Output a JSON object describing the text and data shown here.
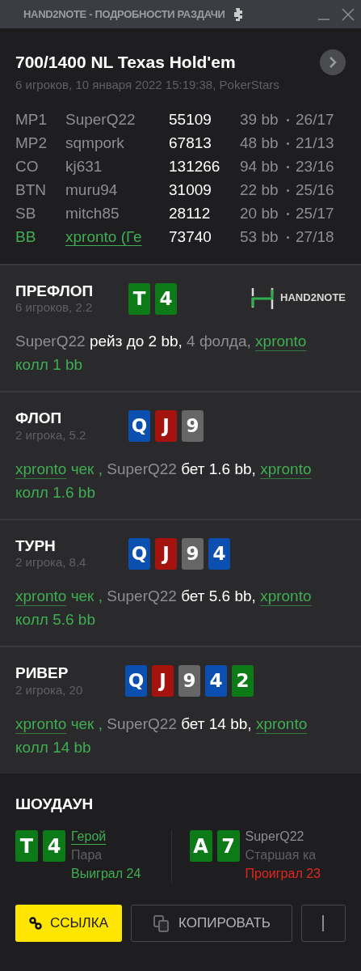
{
  "window": {
    "title": "HAND2NOTE - ПОДРОБНОСТИ РАЗДАЧИ"
  },
  "hand": {
    "title": "700/1400 NL Texas Hold'em",
    "subtitle": "6 игроков, 10 января 2022 15:19:38, PokerStars"
  },
  "players": [
    {
      "position": "MP1",
      "name": "SuperQ22",
      "stack": "55109",
      "bb": "39 bb",
      "stats": "26/17",
      "hero": false
    },
    {
      "position": "MP2",
      "name": "sqmpork",
      "stack": "67813",
      "bb": "48 bb",
      "stats": "21/13",
      "hero": false
    },
    {
      "position": "CO",
      "name": "kj631",
      "stack": "131266",
      "bb": "94 bb",
      "stats": "23/16",
      "hero": false
    },
    {
      "position": "BTN",
      "name": "muru94",
      "stack": "31009",
      "bb": "22 bb",
      "stats": "25/16",
      "hero": false
    },
    {
      "position": "SB",
      "name": "mitch85",
      "stack": "28112",
      "bb": "20 bb",
      "stats": "25/17",
      "hero": false
    },
    {
      "position": "BB",
      "name": "xpronto (Ге",
      "stack": "73740",
      "bb": "53 bb",
      "stats": "27/18",
      "hero": true
    }
  ],
  "streets": [
    {
      "name": "ПРЕФЛОП",
      "info": "6 игроков, 2.2",
      "logo": "HAND2NOTE",
      "cards": [
        {
          "rank": "T",
          "color": "#0b7a17"
        },
        {
          "rank": "4",
          "color": "#0b7a17"
        }
      ],
      "actions": [
        {
          "kind": "player",
          "text": "SuperQ22"
        },
        {
          "kind": "action",
          "text": " рейз до 2 bb,"
        },
        {
          "kind": "player",
          "text": " 4 фолда, "
        },
        {
          "kind": "hero",
          "text": "xpronto"
        },
        {
          "kind": "hero_action",
          "text": " колл 1 bb"
        }
      ]
    },
    {
      "name": "ФЛОП",
      "info": "2 игрока, 5.2",
      "cards": [
        {
          "rank": "Q",
          "color": "#0b50b0"
        },
        {
          "rank": "J",
          "color": "#a5130f"
        },
        {
          "rank": "9",
          "color": "#666666"
        }
      ],
      "actions": [
        {
          "kind": "hero",
          "text": "xpronto"
        },
        {
          "kind": "hero_action",
          "text": " чек ,"
        },
        {
          "kind": "player",
          "text": " SuperQ22"
        },
        {
          "kind": "action",
          "text": " бет 1.6 bb, "
        },
        {
          "kind": "hero",
          "text": "xpronto"
        },
        {
          "kind": "hero_action",
          "text": " колл 1.6 bb"
        }
      ]
    },
    {
      "name": "ТУРН",
      "info": "2 игрока, 8.4",
      "cards": [
        {
          "rank": "Q",
          "color": "#0b50b0"
        },
        {
          "rank": "J",
          "color": "#a5130f"
        },
        {
          "rank": "9",
          "color": "#666666"
        },
        {
          "rank": "4",
          "color": "#0b50b0"
        }
      ],
      "actions": [
        {
          "kind": "hero",
          "text": "xpronto"
        },
        {
          "kind": "hero_action",
          "text": " чек ,"
        },
        {
          "kind": "player",
          "text": " SuperQ22"
        },
        {
          "kind": "action",
          "text": " бет 5.6 bb, "
        },
        {
          "kind": "hero",
          "text": "xpronto"
        },
        {
          "kind": "hero_action",
          "text": " колл 5.6 bb"
        }
      ]
    },
    {
      "name": "РИВЕР",
      "info": "2 игрока, 20",
      "cards": [
        {
          "rank": "Q",
          "color": "#0b50b0"
        },
        {
          "rank": "J",
          "color": "#a5130f"
        },
        {
          "rank": "9",
          "color": "#666666"
        },
        {
          "rank": "4",
          "color": "#0b50b0"
        },
        {
          "rank": "2",
          "color": "#0b7a17"
        }
      ],
      "actions": [
        {
          "kind": "hero",
          "text": "xpronto"
        },
        {
          "kind": "hero_action",
          "text": " чек ,"
        },
        {
          "kind": "player",
          "text": " SuperQ22"
        },
        {
          "kind": "action",
          "text": " бет 14 bb, "
        },
        {
          "kind": "hero",
          "text": "xpronto"
        },
        {
          "kind": "hero_action",
          "text": " колл 14 bb"
        }
      ]
    }
  ],
  "showdown": {
    "title": "ШОУДАУН",
    "hands": [
      {
        "cards": [
          {
            "rank": "T",
            "color": "#0b7a17"
          },
          {
            "rank": "4",
            "color": "#0b7a17"
          }
        ],
        "name": "Герой",
        "hero": true,
        "combo": "Пара",
        "result": "Выиграл 24",
        "won": true
      },
      {
        "cards": [
          {
            "rank": "A",
            "color": "#0b7a17"
          },
          {
            "rank": "7",
            "color": "#0b7a17"
          }
        ],
        "name": "SuperQ22",
        "hero": false,
        "combo": "Старшая ка",
        "result": "Проиграл 23",
        "won": false
      }
    ]
  },
  "buttons": [
    {
      "kind": "link",
      "label": "ССЫЛКА"
    },
    {
      "kind": "copy",
      "label": "КОПИРОВАТЬ"
    },
    {
      "kind": "more"
    }
  ]
}
